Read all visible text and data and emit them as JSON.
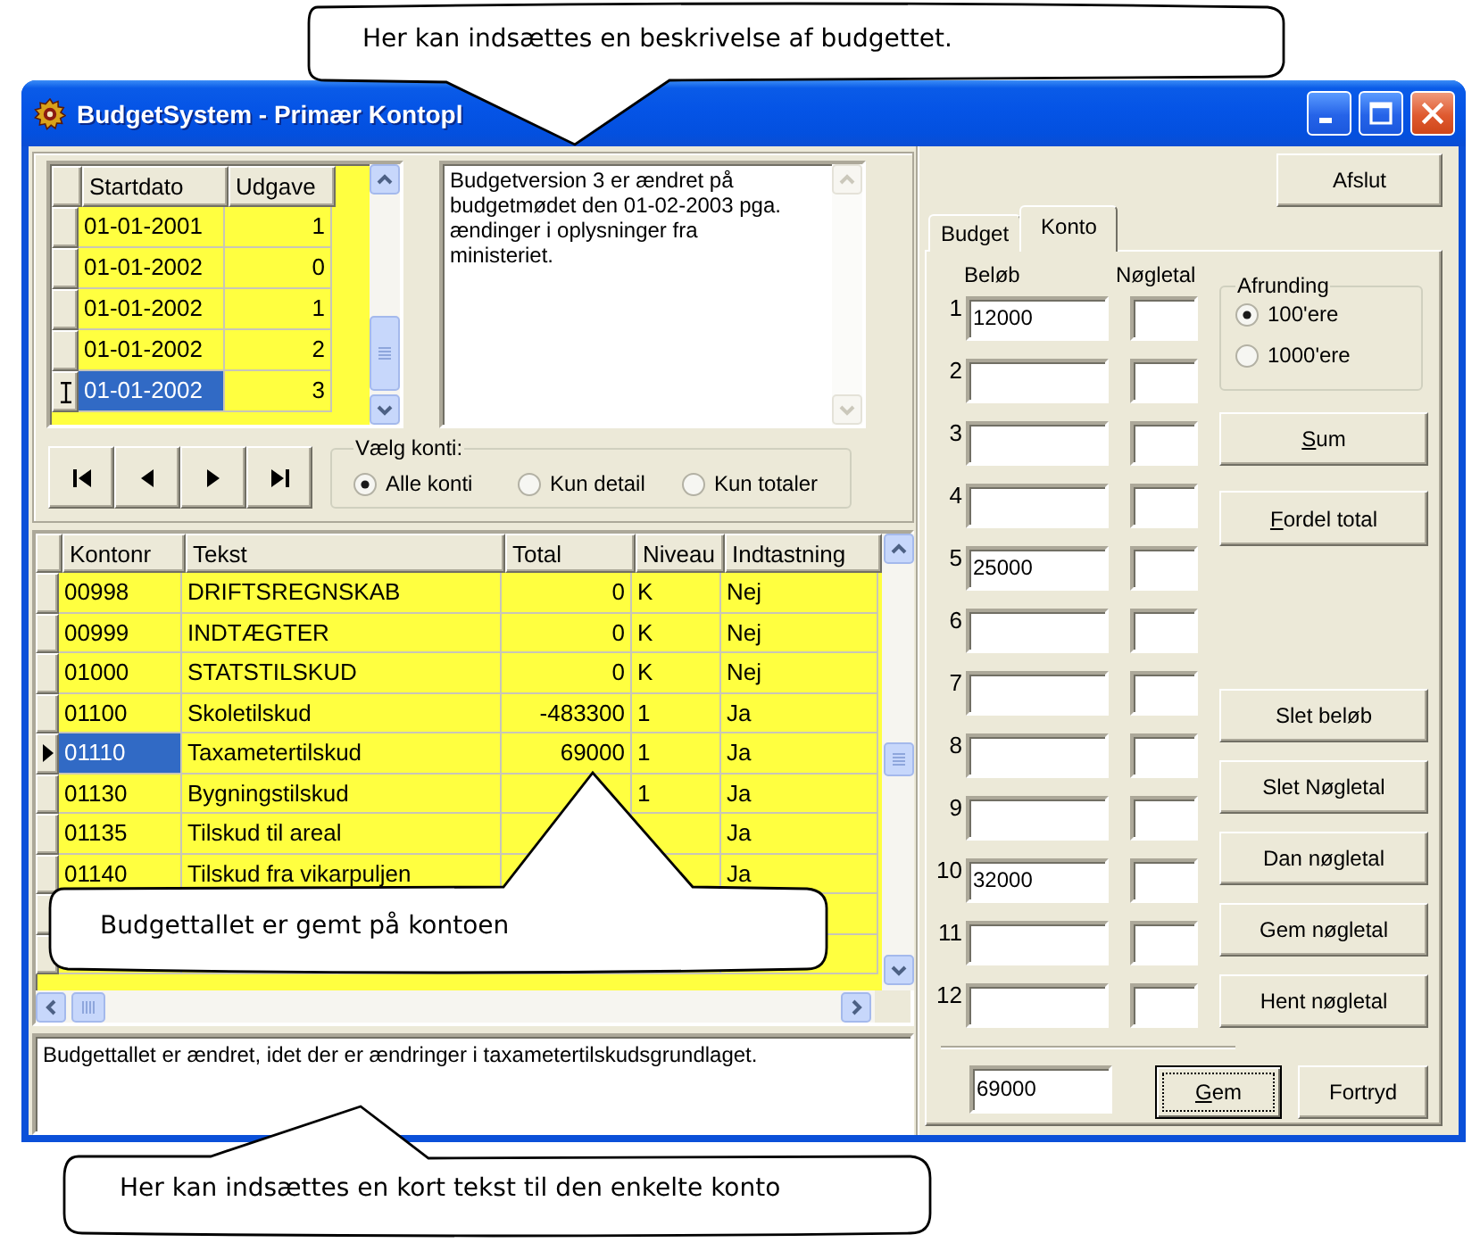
{
  "window": {
    "title": "BudgetSystem - Primær Kontopl"
  },
  "versions": {
    "columns": [
      "Startdato",
      "Udgave"
    ],
    "rows": [
      {
        "startdato": "01-01-2001",
        "udgave": "1",
        "selected": false
      },
      {
        "startdato": "01-01-2002",
        "udgave": "0",
        "selected": false
      },
      {
        "startdato": "01-01-2002",
        "udgave": "1",
        "selected": false
      },
      {
        "startdato": "01-01-2002",
        "udgave": "2",
        "selected": false
      },
      {
        "startdato": "01-01-2002",
        "udgave": "3",
        "selected": true
      }
    ]
  },
  "description": {
    "value": "Budgetversion 3 er ændret på budgetmødet den 01-02-2003 pga. ændinger i oplysninger fra ministeriet."
  },
  "navigation": [
    {
      "kind": "first"
    },
    {
      "kind": "previous"
    },
    {
      "kind": "next"
    },
    {
      "kind": "last"
    }
  ],
  "account_filter": {
    "legend": "Vælg konti:",
    "options": [
      {
        "label": "Alle konti",
        "selected": true
      },
      {
        "label": "Kun detail",
        "selected": false
      },
      {
        "label": "Kun totaler",
        "selected": false
      }
    ]
  },
  "accounts": {
    "columns": [
      "Kontonr",
      "Tekst",
      "Total",
      "Niveau",
      "Indtastning"
    ],
    "rows": [
      {
        "kontonr": "00998",
        "tekst": "DRIFTSREGNSKAB",
        "total": "0",
        "niveau": "K",
        "indtastning": "Nej",
        "selected": false
      },
      {
        "kontonr": "00999",
        "tekst": "INDTÆGTER",
        "total": "0",
        "niveau": "K",
        "indtastning": "Nej",
        "selected": false
      },
      {
        "kontonr": "01000",
        "tekst": "STATSTILSKUD",
        "total": "0",
        "niveau": "K",
        "indtastning": "Nej",
        "selected": false
      },
      {
        "kontonr": "01100",
        "tekst": "Skoletilskud",
        "total": "-483300",
        "niveau": "1",
        "indtastning": "Ja",
        "selected": false
      },
      {
        "kontonr": "01110",
        "tekst": "Taxametertilskud",
        "total": "69000",
        "niveau": "1",
        "indtastning": "Ja",
        "selected": true
      },
      {
        "kontonr": "01130",
        "tekst": "Bygningstilskud",
        "niveau": "1",
        "indtastning": "Ja",
        "selected": false
      },
      {
        "kontonr": "01135",
        "tekst": "Tilskud til areal",
        "indtastning": "Ja",
        "selected": false
      },
      {
        "kontonr": "01140",
        "tekst": "Tilskud fra vikarpuljen",
        "indtastning": "Ja",
        "selected": false
      }
    ]
  },
  "account_note": {
    "value": "Budgettallet er ændret, idet der er ændringer i taxametertilskudsgrundlaget."
  },
  "close_button": {
    "label": "Afslut"
  },
  "tabs": [
    {
      "label": "Budget",
      "selected": false
    },
    {
      "label": "Konto",
      "selected": true
    }
  ],
  "konto": {
    "amount_header": "Beløb",
    "key_header": "Nøgletal",
    "lines": [
      {
        "number": "1",
        "amount": "12000"
      },
      {
        "number": "2"
      },
      {
        "number": "3"
      },
      {
        "number": "4"
      },
      {
        "number": "5",
        "amount": "25000"
      },
      {
        "number": "6"
      },
      {
        "number": "7"
      },
      {
        "number": "8"
      },
      {
        "number": "9"
      },
      {
        "number": "10",
        "amount": "32000"
      },
      {
        "number": "11"
      },
      {
        "number": "12"
      }
    ],
    "rounding": {
      "legend": "Afrunding",
      "options": [
        {
          "label": "100'ere",
          "selected": true
        },
        {
          "label": "1000'ere",
          "selected": false
        }
      ]
    },
    "total_buttons": [
      {
        "label": "Sum",
        "mnemonic": true
      },
      {
        "label": "Fordel total",
        "mnemonic": true
      }
    ],
    "key_buttons": [
      {
        "label": "Slet beløb",
        "mnemonic": false
      },
      {
        "label": "Slet Nøgletal",
        "mnemonic": false
      },
      {
        "label": "Dan nøgletal",
        "mnemonic": false
      },
      {
        "label": "Gem nøgletal",
        "mnemonic": false
      },
      {
        "label": "Hent nøgletal",
        "mnemonic": false
      }
    ],
    "total": {
      "value": "69000"
    },
    "save_button": {
      "label": "Gem",
      "mnemonic": true,
      "default": true
    },
    "cancel_button": {
      "label": "Fortryd"
    }
  },
  "callouts": [
    {
      "text": "Her kan indsættes en beskrivelse af budgettet."
    },
    {
      "text": "Budgettallet er gemt på kontoen"
    },
    {
      "text": "Her kan indsættes en kort tekst til den enkelte konto"
    }
  ]
}
